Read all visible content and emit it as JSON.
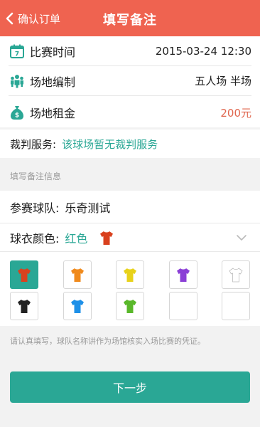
{
  "nav": {
    "back_label": "确认订单",
    "title": "填写备注"
  },
  "info": {
    "time": {
      "label": "比赛时间",
      "value": "2015-03-24 12:30",
      "icon": "calendar-icon"
    },
    "format": {
      "label": "场地编制",
      "value": "五人场 半场",
      "icon": "team-icon"
    },
    "rent": {
      "label": "场地租金",
      "value": "200元",
      "icon": "money-bag-icon"
    }
  },
  "referee": {
    "label": "裁判服务:",
    "value": "该球场暂无裁判服务"
  },
  "section_hint": "填写备注信息",
  "team": {
    "label": "参赛球队:",
    "value": "乐奇测试"
  },
  "jersey": {
    "label": "球衣颜色:",
    "value": "红色",
    "selected_color": "#d9411e"
  },
  "palette": [
    {
      "color": "#d9411e",
      "selected": true
    },
    {
      "color": "#f08a1c",
      "selected": false
    },
    {
      "color": "#e8d21a",
      "selected": false
    },
    {
      "color": "#8b3fd6",
      "selected": false
    },
    {
      "color": "#ffffff",
      "selected": false
    },
    {
      "color": "#222222",
      "selected": false
    },
    {
      "color": "#1e90e8",
      "selected": false
    },
    {
      "color": "#59b82a",
      "selected": false
    },
    {
      "color": null,
      "selected": false
    },
    {
      "color": null,
      "selected": false
    }
  ],
  "note": "请认真填写，球队名称讲作为场馆核实入场比赛的凭证。",
  "next_button": "下一步",
  "colors": {
    "header": "#ef6350",
    "accent": "#2aa795",
    "price": "#e0664e"
  }
}
